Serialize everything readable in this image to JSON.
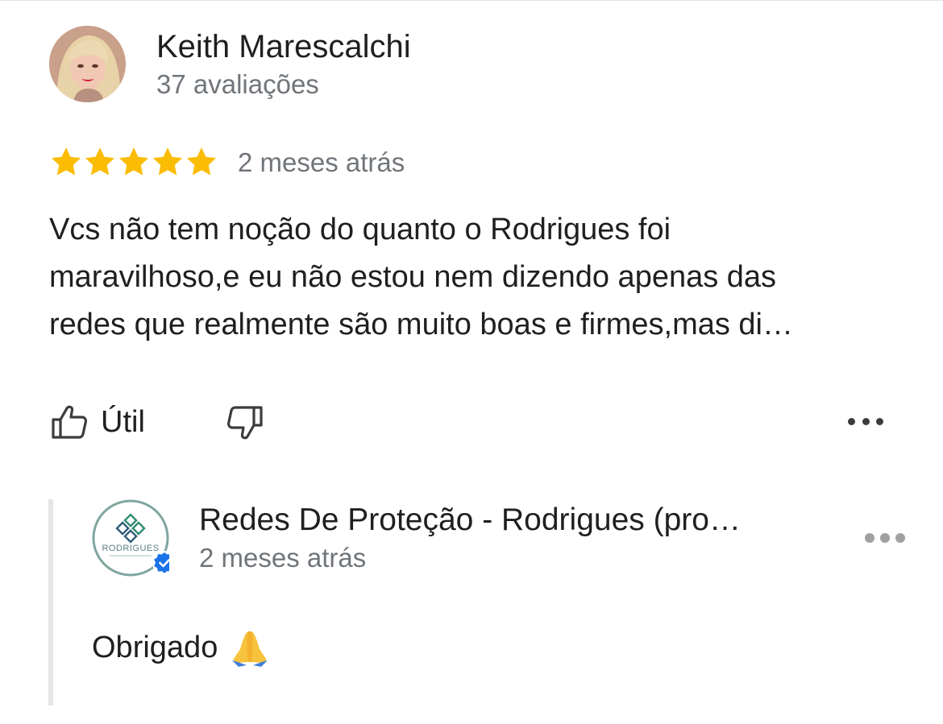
{
  "review": {
    "reviewer_name": "Keith Marescalchi",
    "reviewer_meta": "37 avaliações",
    "rating": 5,
    "rating_max": 5,
    "date": "2 meses atrás",
    "text_lines": [
      "Vcs não tem noção do quanto o Rodrigues foi",
      "maravilhoso,e eu não estou nem dizendo apenas das",
      "redes que realmente são muito boas e firmes,mas di…"
    ],
    "star_color": "#fbbc04"
  },
  "actions": {
    "helpful_label": "Útil",
    "helpful_icon": "thumbs-up-icon",
    "unhelpful_icon": "thumbs-down-icon",
    "more_icon": "more-horizontal-icon"
  },
  "owner_reply": {
    "name": "Redes De Proteção - Rodrigues (pro…",
    "date": "2 meses atrás",
    "text": "Obrigado",
    "emoji_icon": "folded-hands-icon",
    "logo_text": "RODRIGUES",
    "verified_color": "#1a73e8",
    "more_icon": "more-horizontal-icon"
  }
}
